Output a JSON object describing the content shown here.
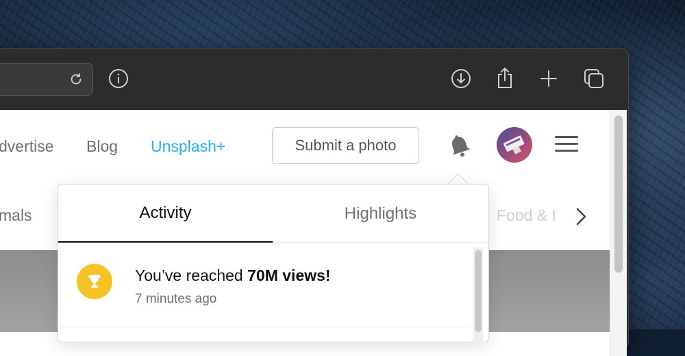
{
  "nav": {
    "advertise_label": "dvertise",
    "blog_label": "Blog",
    "plus_label": "Unsplash+",
    "submit_label": "Submit a photo"
  },
  "categories": {
    "left_partial": "mals",
    "right_partial": "Food & I"
  },
  "notifications_popover": {
    "tabs": [
      {
        "label": "Activity",
        "active": true
      },
      {
        "label": "Highlights",
        "active": false
      }
    ],
    "items": [
      {
        "text_prefix": "You’ve reached ",
        "text_bold": "70M views!",
        "time": "7 minutes ago",
        "icon": "trophy-icon"
      }
    ]
  },
  "colors": {
    "accent_plus": "#1fb0f0",
    "trophy_badge": "#f6c327"
  },
  "icons": {
    "reload": "reload-icon",
    "info": "info-icon",
    "download": "download-icon",
    "share": "share-icon",
    "new_tab": "plus-icon",
    "tabs_overview": "tabs-overview-icon",
    "bell": "bell-icon",
    "menu": "hamburger-menu-icon",
    "next": "chevron-right-icon"
  }
}
